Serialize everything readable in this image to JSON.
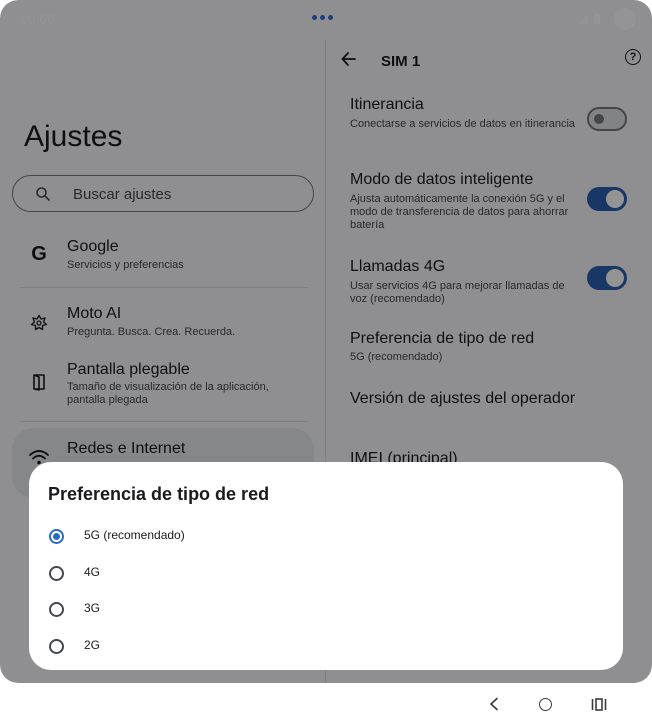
{
  "status_bar": {
    "time": "10:00"
  },
  "left_panel": {
    "title": "Ajustes",
    "search_placeholder": "Buscar ajustes",
    "items": [
      {
        "title": "Google",
        "subtitle": "Servicios y preferencias",
        "icon": "google-icon"
      },
      {
        "title": "Moto AI",
        "subtitle": "Pregunta. Busca. Crea. Recuerda.",
        "icon": "moto-ai-icon"
      },
      {
        "title": "Pantalla plegable",
        "subtitle": "Tamaño de visualización de la aplicación, pantalla plegada",
        "icon": "foldable-display-icon"
      },
      {
        "title": "Redes e Internet",
        "subtitle": "",
        "icon": "wifi-icon"
      }
    ]
  },
  "right_panel": {
    "title": "SIM 1",
    "items": [
      {
        "title": "Itinerancia",
        "subtitle": "Conectarse a servicios de datos en itinerancia",
        "toggle": "off"
      },
      {
        "title": "Modo de datos inteligente",
        "subtitle": "Ajusta automáticamente la conexión 5G y el modo de transferencia de datos para ahorrar batería",
        "toggle": "on"
      },
      {
        "title": "Llamadas 4G",
        "subtitle": "Usar servicios 4G para mejorar llamadas de voz (recomendado)",
        "toggle": "on"
      },
      {
        "title": "Preferencia de tipo de red",
        "subtitle": "5G (recomendado)"
      },
      {
        "title": "Versión de ajustes del operador",
        "subtitle": ""
      },
      {
        "title": "IMEI (principal)",
        "subtitle": ""
      }
    ]
  },
  "dialog": {
    "title": "Preferencia de tipo de red",
    "options": [
      {
        "label": "5G (recomendado)",
        "selected": true
      },
      {
        "label": "4G",
        "selected": false
      },
      {
        "label": "3G",
        "selected": false
      },
      {
        "label": "2G",
        "selected": false
      }
    ]
  },
  "colors": {
    "accent": "#2a6cc4",
    "toggle_on": "#2a5fb0",
    "scrim": "rgba(0,0,0,0.42)"
  }
}
